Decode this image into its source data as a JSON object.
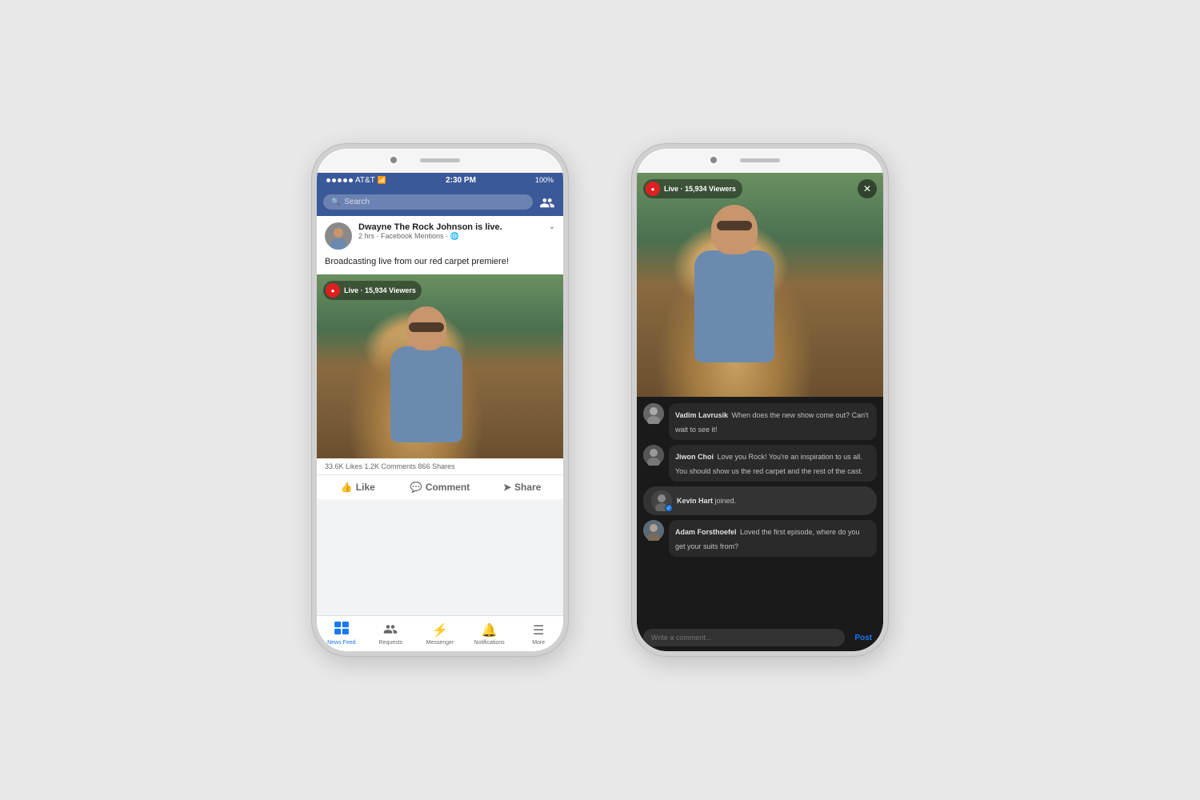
{
  "page": {
    "background": "#e8e8e8"
  },
  "phone1": {
    "status_bar": {
      "carrier": "AT&T",
      "wifi": "wifi",
      "time": "2:30 PM",
      "battery": "100%"
    },
    "header": {
      "search_placeholder": "Search",
      "friend_icon": "👥"
    },
    "post": {
      "user_name": "Dwayne The Rock Johnson is live.",
      "meta": "2 hrs · Facebook Mentions · 🌐",
      "text": "Broadcasting live from our red carpet premiere!",
      "live_label": "Live",
      "viewers": "15,934 Viewers",
      "stats": "33.6K Likes  1.2K Comments  866 Shares",
      "action_like": "Like",
      "action_comment": "Comment",
      "action_share": "Share"
    },
    "bottom_nav": {
      "items": [
        {
          "label": "News Feed",
          "icon": "⊞",
          "active": true
        },
        {
          "label": "Requests",
          "icon": "👥",
          "active": false
        },
        {
          "label": "Messenger",
          "icon": "💬",
          "active": false
        },
        {
          "label": "Notifications",
          "icon": "🔔",
          "active": false
        },
        {
          "label": "More",
          "icon": "☰",
          "active": false
        }
      ]
    }
  },
  "phone2": {
    "live_label": "Live",
    "viewers": "15,934 Viewers",
    "close": "✕",
    "comments": [
      {
        "user": "Vadim Lavrusik",
        "text": "When does the new show come out? Can't wait to see it!"
      },
      {
        "user": "Jiwon Choi",
        "text": "Love you Rock! You're an inspiration to us all. You should show us the red carpet and the rest of the cast."
      }
    ],
    "join": {
      "user": "Kevin Hart",
      "text": "joined."
    },
    "comments2": [
      {
        "user": "Adam Forsthoefel",
        "text": "Loved the first episode, where do you get your suits from?"
      }
    ],
    "comment_placeholder": "Write a comment...",
    "post_button": "Post"
  }
}
